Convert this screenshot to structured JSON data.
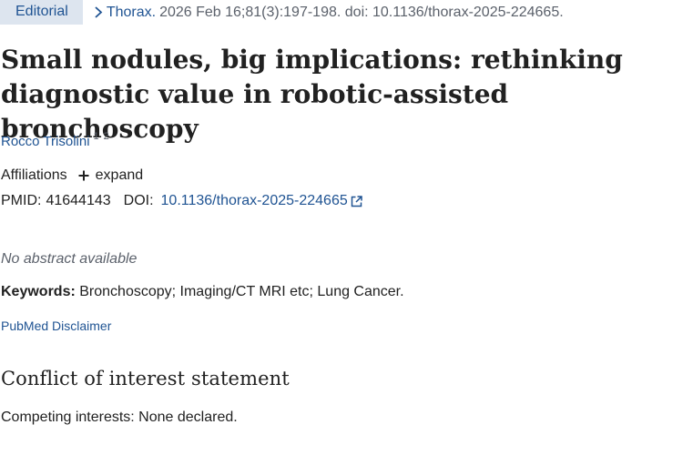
{
  "header": {
    "publication_type": "Editorial",
    "journal": "Thorax.",
    "citation": "2026 Feb 16;81(3):197-198. doi: 10.1136/thorax-2025-224665."
  },
  "article": {
    "title": "Small nodules, big implications: rethinking diagnostic value in robotic-assisted bronchoscopy",
    "authors": [
      {
        "name": "Rocco Trisolini",
        "affiliations": [
          "1",
          "2"
        ]
      }
    ],
    "affiliations_label": "Affiliations",
    "expand_label": "expand",
    "pmid_label": "PMID:",
    "pmid": "41644143",
    "doi_label": "DOI:",
    "doi": "10.1136/thorax-2025-224665",
    "abstract_text": "No abstract available",
    "keywords_label": "Keywords:",
    "keywords": "Bronchoscopy; Imaging/CT MRI etc; Lung Cancer.",
    "disclaimer_link": "PubMed Disclaimer"
  },
  "conflict": {
    "heading": "Conflict of interest statement",
    "text": "Competing interests: None declared."
  },
  "icons": {
    "citation_chevron": "chevron-right-icon",
    "expand": "plus-icon",
    "doi_external": "external-link-icon"
  },
  "colors": {
    "link": "#205493",
    "badge_background": "#dde5ef",
    "muted_text": "#5b616b",
    "body_text": "#212121"
  }
}
